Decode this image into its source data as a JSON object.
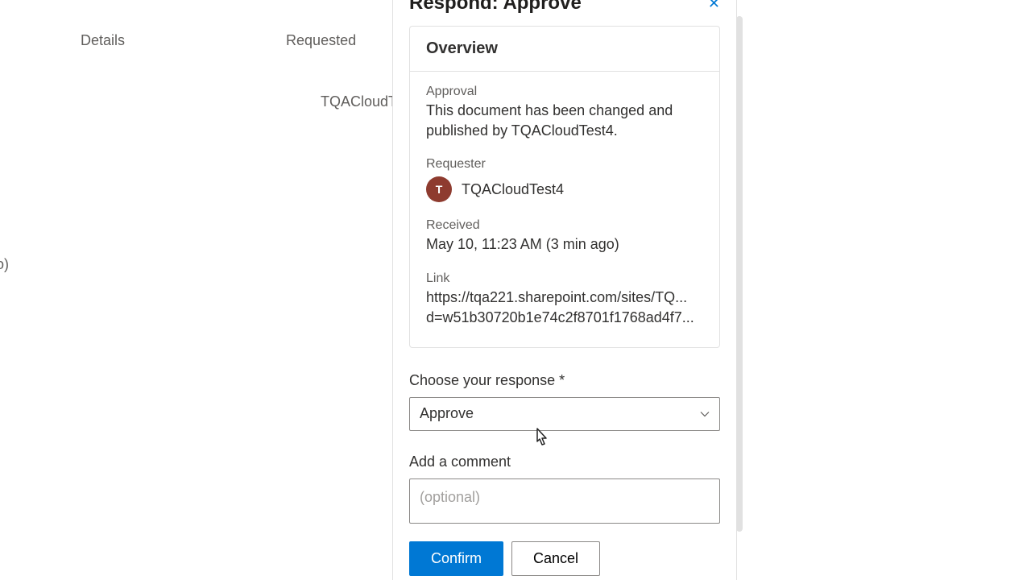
{
  "panel": {
    "title": "Respond: Approve",
    "overview_header": "Overview",
    "approval_label": "Approval",
    "approval_text": "This document has been changed and published by TQACloudTest4.",
    "requester_label": "Requester",
    "requester_initial": "T",
    "requester_name": "TQACloudTest4",
    "received_label": "Received",
    "received_value": "May 10, 11:23 AM (3 min ago)",
    "link_label": "Link",
    "link_line1": "https://tqa221.sharepoint.com/sites/TQ...",
    "link_line2": "d=w51b30720b1e74c2f8701f1768ad4f7...",
    "response_label": "Choose your response *",
    "response_value": "Approve",
    "comment_label": "Add a comment",
    "comment_placeholder": "(optional)",
    "confirm_label": "Confirm",
    "cancel_label": "Cancel"
  },
  "background": {
    "col1": "Details",
    "col2": "Requested",
    "row_val": "TQACloudTes",
    "side": "o)"
  }
}
